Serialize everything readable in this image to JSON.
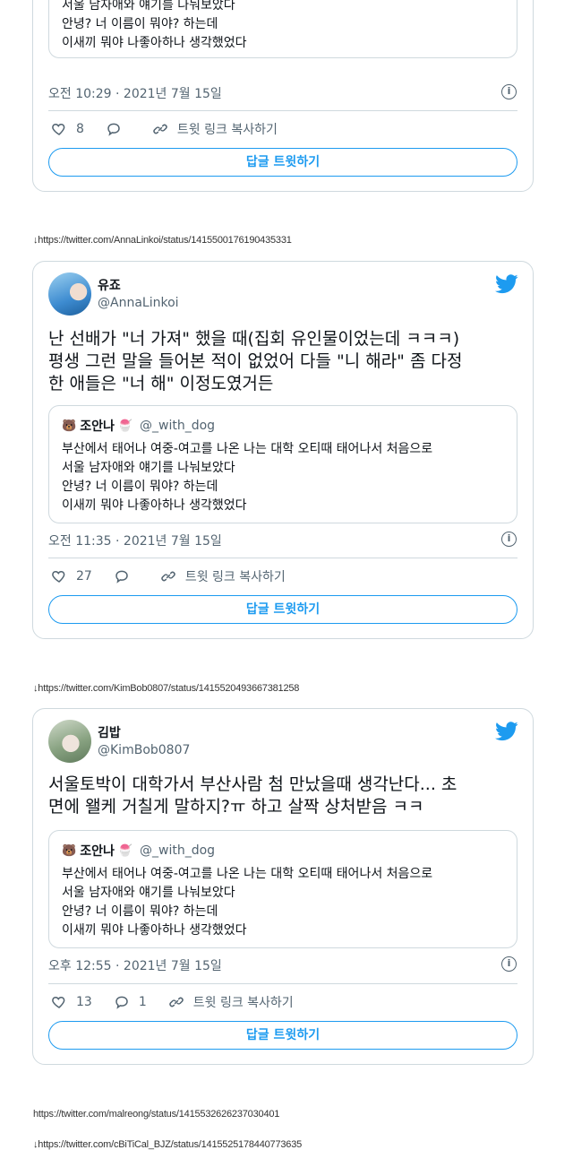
{
  "top_tweet": {
    "quote_text": "부산에서 태어나 여중-여고를 나온 나는 대학 오티때 태어나서 처음으로\n서울 남자애와 얘기를 나눠보았다\n안녕? 너 이름이 뭐야? 하는데\n이새끼 뭐야 나좋아하나 생각했었다",
    "timestamp": "오전 10:29 · 2021년 7월 15일",
    "likes": "8",
    "replies": "",
    "copy_link": "트윗 링크 복사하기",
    "reply_button": "답글 트윗하기"
  },
  "link_1": "↓https://twitter.com/AnnaLinkoi/status/1415500176190435331",
  "tweet_2": {
    "name": "유죠",
    "handle": "@AnnaLinkoi",
    "text": "난 선배가 \"너 가져\" 했을 때(집회 유인물이었는데 ㅋㅋㅋ)\n평생 그런 말을 들어본 적이 없었어 다들 \"니 해라\" 좀 다정\n한 애들은 \"너 해\" 이정도였거든",
    "quote": {
      "emoji_left": "🐻",
      "name": "조안나",
      "emoji_right": "🍧",
      "handle": "@_with_dog",
      "text": "부산에서 태어나 여중-여고를 나온 나는 대학 오티때 태어나서 처음으로\n서울 남자애와 얘기를 나눠보았다\n안녕? 너 이름이 뭐야? 하는데\n이새끼 뭐야 나좋아하나 생각했었다"
    },
    "timestamp": "오전 11:35 · 2021년 7월 15일",
    "likes": "27",
    "replies": "",
    "copy_link": "트윗 링크 복사하기",
    "reply_button": "답글 트윗하기"
  },
  "link_2": "↓https://twitter.com/KimBob0807/status/1415520493667381258",
  "tweet_3": {
    "name": "김밥",
    "handle": "@KimBob0807",
    "text": "서울토박이 대학가서 부산사람 첨 만났을때 생각난다... 초\n면에 왤케 거칠게 말하지?ㅠ 하고 살짝 상처받음 ㅋㅋ",
    "quote": {
      "emoji_left": "🐻",
      "name": "조안나",
      "emoji_right": "🍧",
      "handle": "@_with_dog",
      "text": "부산에서 태어나 여중-여고를 나온 나는 대학 오티때 태어나서 처음으로\n서울 남자애와 얘기를 나눠보았다\n안녕? 너 이름이 뭐야? 하는데\n이새끼 뭐야 나좋아하나 생각했었다"
    },
    "timestamp": "오후 12:55 · 2021년 7월 15일",
    "likes": "13",
    "replies": "1",
    "copy_link": "트윗 링크 복사하기",
    "reply_button": "답글 트윗하기"
  },
  "link_3": "https://twitter.com/malreong/status/1415532626237030401",
  "link_4": "↓https://twitter.com/cBiTiCal_BJZ/status/1415525178440773635",
  "colors": {
    "accent": "#1d9bf0",
    "muted": "#536471",
    "border": "#cfd9de"
  }
}
